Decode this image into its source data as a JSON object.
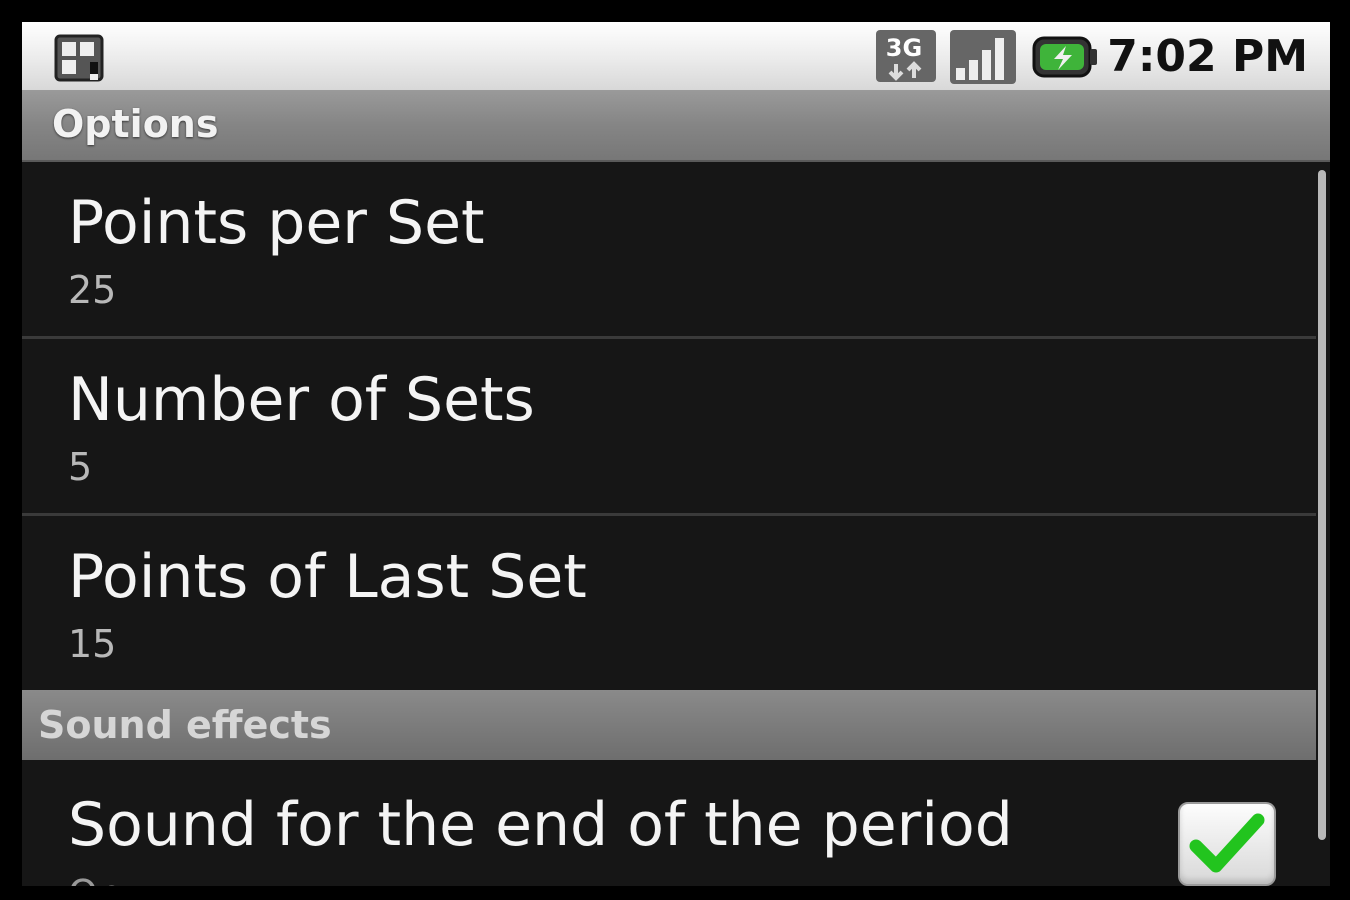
{
  "status_bar": {
    "time": "7:02 PM",
    "network_label": "3G",
    "icons": [
      "sd-card-icon",
      "network-3g-icon",
      "signal-strength-icon",
      "battery-charging-icon"
    ]
  },
  "title_bar": {
    "title": "Options"
  },
  "preferences": [
    {
      "title": "Points per Set",
      "summary": "25"
    },
    {
      "title": "Number of Sets",
      "summary": "5"
    },
    {
      "title": "Points of Last Set",
      "summary": "15"
    }
  ],
  "sound_category": {
    "label": "Sound effects"
  },
  "sound_pref": {
    "title": "Sound for the end of the period",
    "summary": "On",
    "checked": true
  },
  "colors": {
    "checkmark": "#22c41e",
    "background": "#161616",
    "title_bar": "#858585"
  }
}
